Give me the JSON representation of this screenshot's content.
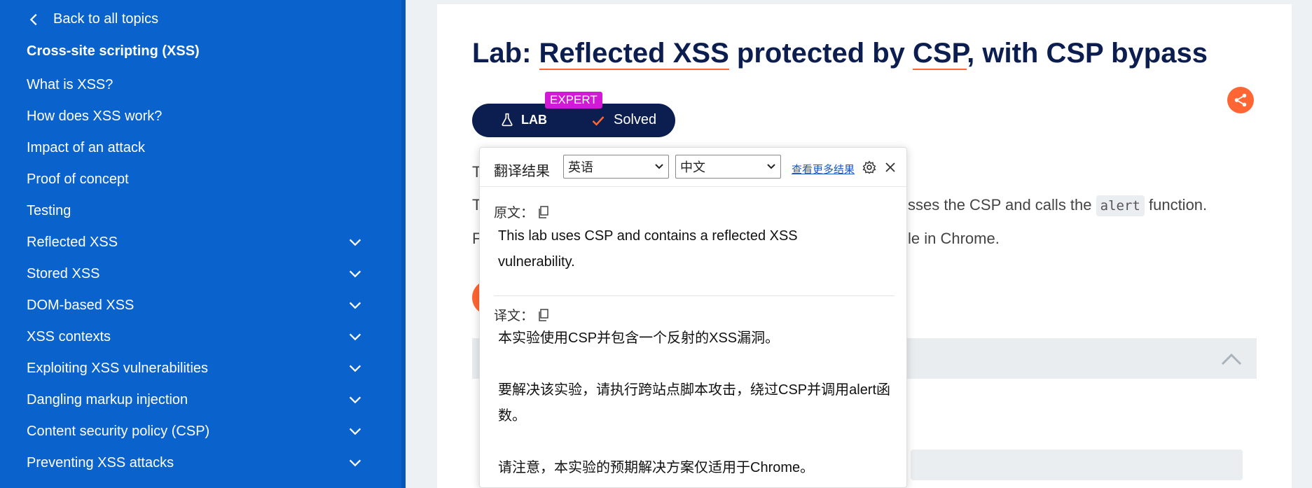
{
  "sidebar": {
    "back_label": "Back to all topics",
    "topic_title": "Cross-site scripting (XSS)",
    "items": [
      {
        "label": "What is XSS?",
        "expandable": false
      },
      {
        "label": "How does XSS work?",
        "expandable": false
      },
      {
        "label": "Impact of an attack",
        "expandable": false
      },
      {
        "label": "Proof of concept",
        "expandable": false
      },
      {
        "label": "Testing",
        "expandable": false
      },
      {
        "label": "Reflected XSS",
        "expandable": true
      },
      {
        "label": "Stored XSS",
        "expandable": true
      },
      {
        "label": "DOM-based XSS",
        "expandable": true
      },
      {
        "label": "XSS contexts",
        "expandable": true
      },
      {
        "label": "Exploiting XSS vulnerabilities",
        "expandable": true
      },
      {
        "label": "Dangling markup injection",
        "expandable": true
      },
      {
        "label": "Content security policy (CSP)",
        "expandable": true
      },
      {
        "label": "Preventing XSS attacks",
        "expandable": true
      }
    ]
  },
  "main": {
    "title_prefix": "Lab: ",
    "title_part1": "Reflected XSS",
    "title_part2": " protected by ",
    "title_part3": "CSP",
    "title_part4": ", with CSP bypass",
    "lab_label": "LAB",
    "level_badge": "EXPERT",
    "status": "Solved",
    "line1_start": "T",
    "line2_start": "T",
    "line2_end": "sses the CSP and calls the",
    "line2_code": "alert",
    "line2_tail": "function.",
    "line3_start": "F",
    "line3_end": "le in Chrome."
  },
  "translate_popup": {
    "title": "翻译结果",
    "source_lang": "英语",
    "target_lang": "中文",
    "more_results": "查看更多结果",
    "original_label": "原文：",
    "original_text": "This lab uses CSP and contains a reflected XSS vulnerability.",
    "translation_label": "译文：",
    "translation_p1": "本实验使用CSP并包含一个反射的XSS漏洞。",
    "translation_p2": "要解决该实验，请执行跨站点脚本攻击，绕过CSP并调用alert函数。",
    "translation_p3": "请注意，本实验的预期解决方案仅适用于Chrome。"
  },
  "colors": {
    "sidebar_bg": "#0a62cc",
    "title_navy": "#0b1e4f",
    "accent_orange": "#ff6633",
    "expert_magenta": "#d119d6"
  }
}
